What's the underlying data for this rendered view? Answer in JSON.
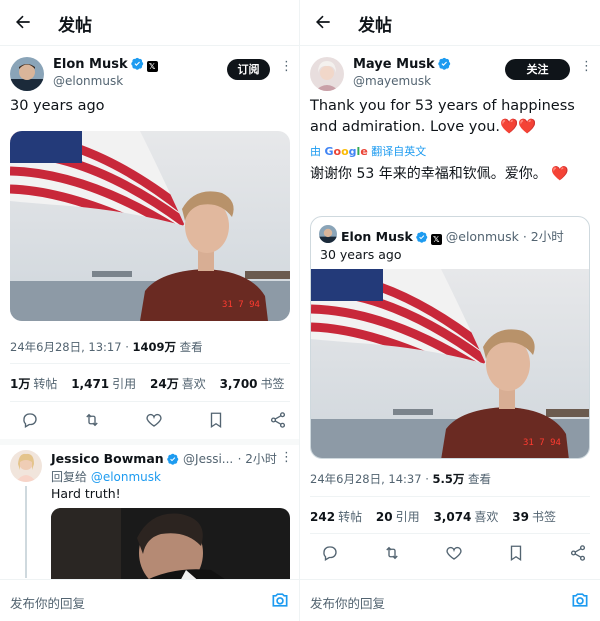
{
  "common": {
    "page_title": "发帖",
    "reply_placeholder": "发布你的回复",
    "x_badge": "𝕏"
  },
  "left": {
    "author": {
      "name": "Elon Musk",
      "handle": "@elonmusk",
      "subscribe_label": "订阅"
    },
    "text": "30 years ago",
    "meta": {
      "date": "24年6月28日, 13:17 · ",
      "views": "1409万",
      "views_label": " 查看"
    },
    "stats": [
      {
        "value": "1万",
        "label": "转帖"
      },
      {
        "value": "1,471",
        "label": "引用"
      },
      {
        "value": "24万",
        "label": "喜欢"
      },
      {
        "value": "3,700",
        "label": "书签"
      }
    ],
    "reply": {
      "name": "Jessico Bowman",
      "handle": "@Jessi...",
      "time": "· 2小时",
      "replying_to_prefix": "回复给 ",
      "replying_to": "@elonmusk",
      "text": "Hard truth!"
    }
  },
  "right": {
    "author": {
      "name": "Maye Musk",
      "handle": "@mayemusk",
      "follow_label": "关注"
    },
    "text": "Thank you for 53 years of happiness and admiration. Love you.",
    "text_hearts": "❤️❤️",
    "translate": {
      "prefix": "由 ",
      "google": "Google",
      "suffix": " 翻译自英文"
    },
    "translated": "谢谢你 53 年来的幸福和钦佩。爱你。",
    "translated_hearts": "❤️",
    "quote": {
      "name": "Elon Musk",
      "handle": "@elonmusk",
      "time": "· 2小时",
      "text": "30 years ago"
    },
    "meta": {
      "date": "24年6月28日, 14:37 · ",
      "views": "5.5万",
      "views_label": " 查看"
    },
    "stats": [
      {
        "value": "242",
        "label": "转帖"
      },
      {
        "value": "20",
        "label": "引用"
      },
      {
        "value": "3,074",
        "label": "喜欢"
      },
      {
        "value": "39",
        "label": "书签"
      }
    ]
  },
  "photo_overlay_text": "31 7 94",
  "colors": {
    "accent": "#1d9bf0",
    "heart": "#f4212e",
    "text": "#0f1419",
    "muted": "#536471"
  }
}
